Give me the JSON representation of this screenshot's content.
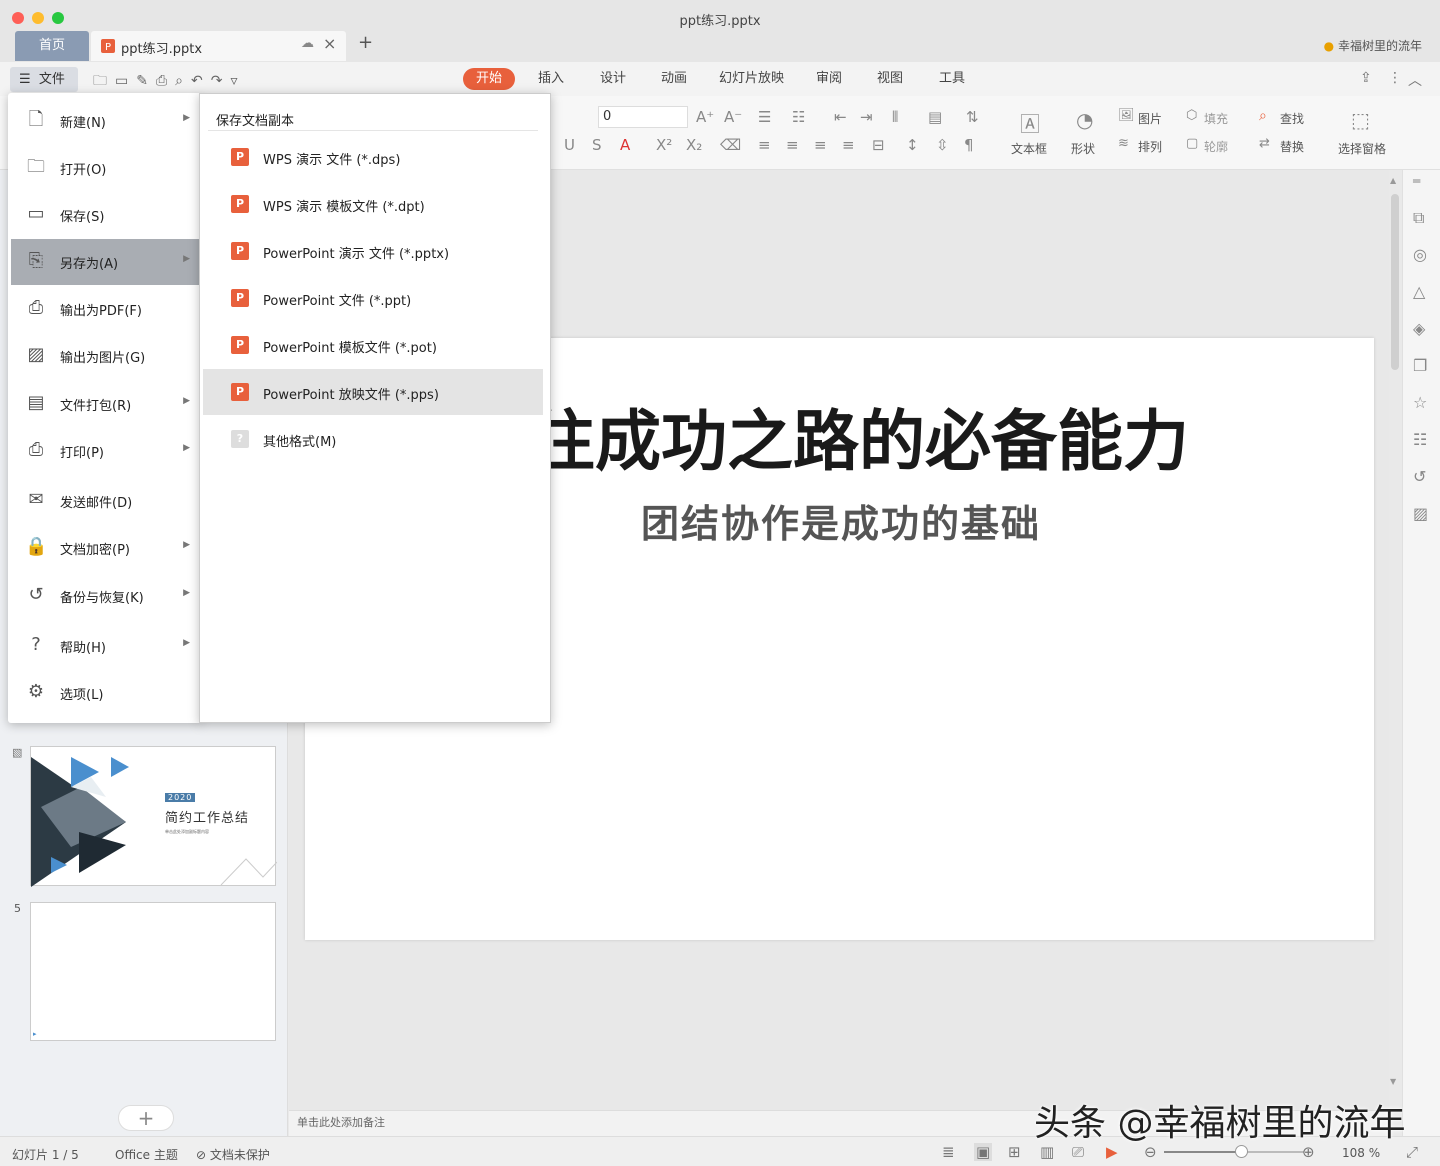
{
  "window": {
    "title": "ppt练习.pptx"
  },
  "tabs": {
    "home": "首页",
    "doc": "ppt练习.pptx",
    "user": "幸福树里的流年"
  },
  "ribbon": {
    "file": "文件",
    "tabs": [
      "开始",
      "插入",
      "设计",
      "动画",
      "幻灯片放映",
      "审阅",
      "视图",
      "工具"
    ]
  },
  "toolbar": {
    "font_size": "0",
    "textbox": "文本框",
    "shape": "形状",
    "picture": "图片",
    "arrange": "排列",
    "fill": "填充",
    "outline": "轮廓",
    "find": "查找",
    "replace": "替换",
    "select_pane": "选择窗格"
  },
  "file_menu": {
    "items": [
      {
        "label": "新建(N)",
        "icon": "new-doc-icon",
        "arrow": true
      },
      {
        "label": "打开(O)",
        "icon": "folder-icon",
        "arrow": false
      },
      {
        "label": "保存(S)",
        "icon": "save-icon",
        "arrow": false
      },
      {
        "label": "另存为(A)",
        "icon": "save-as-icon",
        "arrow": true
      },
      {
        "label": "输出为PDF(F)",
        "icon": "pdf-icon",
        "arrow": false
      },
      {
        "label": "输出为图片(G)",
        "icon": "image-icon",
        "arrow": false
      },
      {
        "label": "文件打包(R)",
        "icon": "package-icon",
        "arrow": true
      },
      {
        "label": "打印(P)",
        "icon": "printer-icon",
        "arrow": true
      },
      {
        "label": "发送邮件(D)",
        "icon": "mail-icon",
        "arrow": false
      },
      {
        "label": "文档加密(P)",
        "icon": "lock-doc-icon",
        "arrow": true
      },
      {
        "label": "备份与恢复(K)",
        "icon": "backup-icon",
        "arrow": true
      },
      {
        "label": "帮助(H)",
        "icon": "help-icon",
        "arrow": true
      },
      {
        "label": "选项(L)",
        "icon": "gear-icon",
        "arrow": false
      }
    ],
    "selected": 3
  },
  "save_as_menu": {
    "header": "保存文档副本",
    "items": [
      "WPS 演示 文件 (*.dps)",
      "WPS 演示 模板文件 (*.dpt)",
      "PowerPoint 演示 文件 (*.pptx)",
      "PowerPoint 文件 (*.ppt)",
      "PowerPoint 模板文件 (*.pot)",
      "PowerPoint 放映文件 (*.pps)",
      "其他格式(M)"
    ],
    "selected": 5
  },
  "slides": {
    "thumb4": {
      "badge": "2020",
      "title": "简约工作总结",
      "sub": "单击此处添加副标题内容"
    },
    "thumb5_num": "5"
  },
  "slide": {
    "title": "往成功之路的必备能力",
    "subtitle": "团结协作是成功的基础"
  },
  "notes": "单击此处添加备注",
  "status": {
    "slide_count": "幻灯片 1 / 5",
    "theme": "Office 主题",
    "protect": "文档未保护",
    "zoom": "108 %",
    "zoom_fraction": 0.55
  },
  "watermark": "头条 @幸福树里的流年",
  "colors": {
    "accent": "#e8603c",
    "selected_menu": "#a9adb3"
  }
}
